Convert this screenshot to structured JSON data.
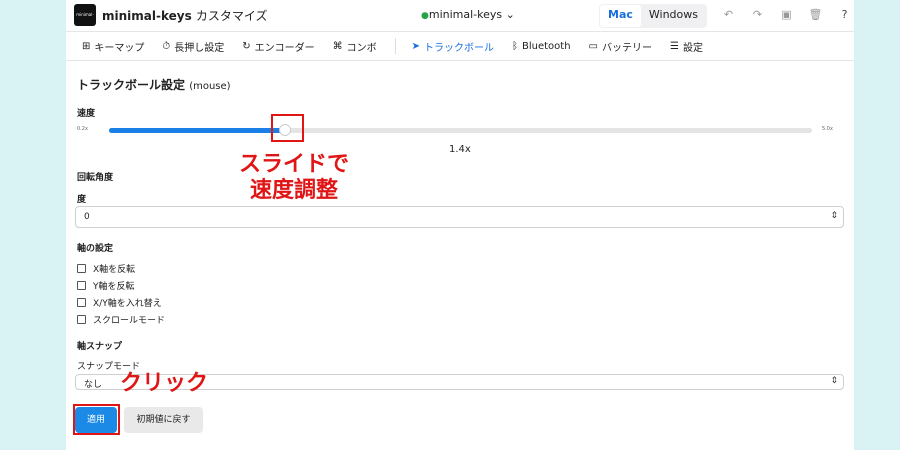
{
  "app": {
    "logo_text": "minimal-keys",
    "title": "minimal-keys",
    "title_suffix": "カスタマイズ",
    "device": "minimal-keys",
    "os_options": [
      "Mac",
      "Windows"
    ],
    "os_selected": "Mac"
  },
  "nav": {
    "items": [
      {
        "icon": "keyboard-grid-icon",
        "label": "キーマップ"
      },
      {
        "icon": "timer-icon",
        "label": "長押し設定"
      },
      {
        "icon": "rotate-icon",
        "label": "エンコーダー"
      },
      {
        "icon": "combo-icon",
        "label": "コンボ"
      },
      {
        "icon": "pointer-icon",
        "label": "トラックボール",
        "active": true
      },
      {
        "icon": "bluetooth-icon",
        "label": "Bluetooth"
      },
      {
        "icon": "battery-icon",
        "label": "バッテリー"
      },
      {
        "icon": "sliders-icon",
        "label": "設定"
      }
    ]
  },
  "main": {
    "title": "トラックボール設定",
    "title_sub": "(mouse)",
    "speed": {
      "label": "速度",
      "min_label": "0.2x",
      "max_label": "5.0x",
      "min": 0.2,
      "max": 5.0,
      "value": 1.4,
      "value_text": "1.4x"
    },
    "rotation": {
      "label": "回転角度",
      "unit_label": "度",
      "value": "0"
    },
    "axis": {
      "label": "軸の設定",
      "options": [
        "X軸を反転",
        "Y軸を反転",
        "X/Y軸を入れ替え",
        "スクロールモード"
      ]
    },
    "snap": {
      "label": "軸スナップ",
      "mode_label": "スナップモード",
      "value": "なし"
    },
    "apply_label": "適用",
    "reset_label": "初期値に戻す"
  },
  "annotations": {
    "slider_note_line1": "スライドで",
    "slider_note_line2": "速度調整",
    "click_note": "クリック",
    "color": "#e01515"
  },
  "colors": {
    "accent": "#1a7fe6",
    "background": "#d9f3f5"
  }
}
